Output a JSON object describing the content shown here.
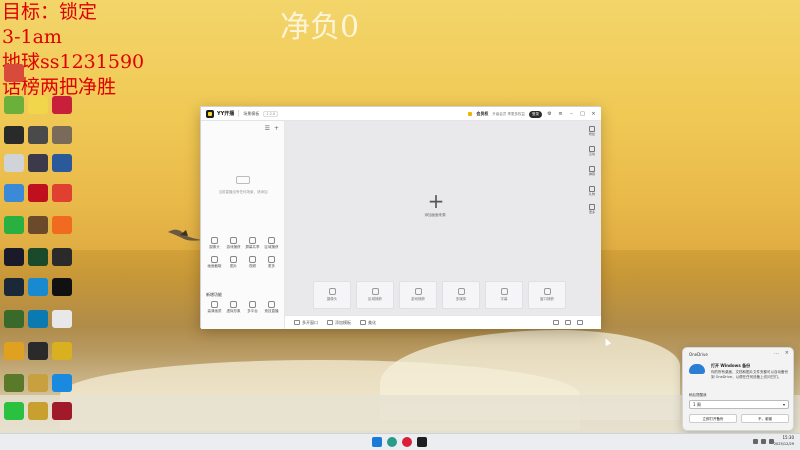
{
  "overlay": {
    "big_title": "净负0",
    "lines": [
      "目标：锁定",
      "3-1am",
      "地球ss1231590",
      "话榜两把净胜"
    ]
  },
  "window": {
    "app_name": "YY开播",
    "tab": "场景模板",
    "version": "1.2.0",
    "title_right_bold": "会员权",
    "title_right_small": "升级会员 享更多权益",
    "login": "登录",
    "tooltip": "完善你的资料，免费送会员福利",
    "left_panel": {
      "empty_text": "当前直播没有任何场景，请添加",
      "source_items": [
        "摄像头",
        "游戏捕获",
        "屏幕共享",
        "区域捕获",
        "画面截取",
        "图片",
        "视频",
        "更多"
      ],
      "section_title": "新增功能",
      "feature_items": [
        "高清画质",
        "虚拟形象",
        "多平台",
        "竞技直播"
      ]
    },
    "main": {
      "add_text": "添加画面来源",
      "tiles": [
        "摄像头",
        "区域捕获",
        "游戏捕获",
        "多媒体",
        "字幕",
        "窗口捕获"
      ]
    },
    "bottom_bar": [
      "多开窗口",
      "添加模板",
      "美化"
    ],
    "right_sidebar": [
      "粉丝",
      "互动",
      "弹幕",
      "礼物",
      "更多"
    ]
  },
  "notification": {
    "app": "OneDrive",
    "title": "打开 Windows 备份",
    "body": "你的所有桌面、文档和图片文件夹都可以自动备份到 OneDrive，以便在任何设备上访问它们。",
    "label": "稍后提醒我",
    "select_value": "1 周",
    "button_primary": "立即打开备份",
    "button_secondary": "不，谢谢"
  },
  "taskbar": {
    "time": "15:30",
    "date": "2025/12/29"
  },
  "colors": {
    "overlay_text": "#e00000",
    "app_accent": "#f7d82a",
    "onedrive_blue": "#2a7fd4"
  }
}
